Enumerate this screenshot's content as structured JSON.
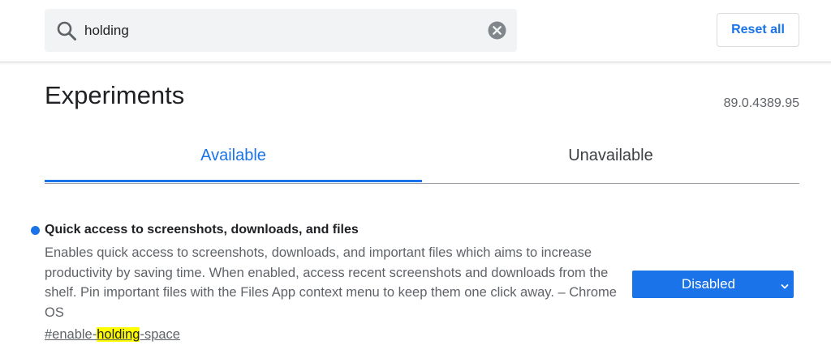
{
  "search": {
    "value": "holding",
    "icon": "search-icon",
    "clear_icon": "close-circle-icon"
  },
  "header": {
    "reset_label": "Reset all"
  },
  "title": {
    "heading": "Experiments",
    "version": "89.0.4389.95"
  },
  "tabs": [
    {
      "label": "Available",
      "selected": true
    },
    {
      "label": "Unavailable",
      "selected": false
    }
  ],
  "experiment": {
    "title": "Quick access to screenshots, downloads, and files",
    "description": "Enables quick access to screenshots, downloads, and important files which aims to increase productivity by saving time. When enabled, access recent screenshots and downloads from the shelf. Pin important files with the Files App context menu to keep them one click away. – Chrome OS",
    "link_prefix": "#enable-",
    "link_match": "holding",
    "link_suffix": "-space",
    "state": "Disabled"
  },
  "colors": {
    "accent": "#1a73e8",
    "highlight": "#ffff00",
    "search_bg": "#f1f3f4",
    "secondary_text": "#5f6368"
  }
}
